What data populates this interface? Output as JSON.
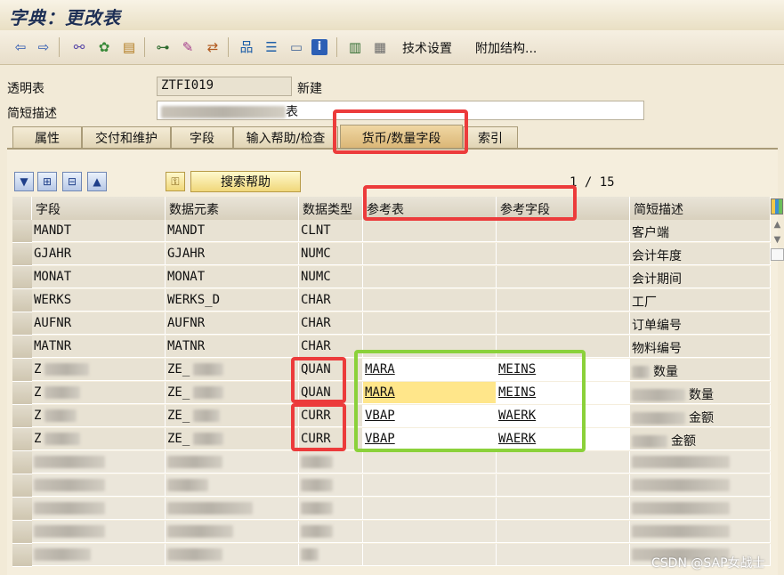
{
  "window": {
    "title": "字典：更改表"
  },
  "toolbar": {
    "tech_settings": "技术设置",
    "append_structure": "附加结构..."
  },
  "header": {
    "transparent_table_label": "透明表",
    "table_name": "ZTFI019",
    "status": "新建",
    "short_desc_label": "简短描述",
    "short_desc_suffix": "表"
  },
  "tabs": [
    {
      "label": "属性"
    },
    {
      "label": "交付和维护"
    },
    {
      "label": "字段"
    },
    {
      "label": "输入帮助/检查"
    },
    {
      "label": "货币/数量字段"
    },
    {
      "label": "索引"
    }
  ],
  "grid_toolbar": {
    "search_help": "搜索帮助",
    "pager": "1 / 15"
  },
  "columns": [
    "字段",
    "数据元素",
    "数据类型",
    "参考表",
    "参考字段",
    "简短描述"
  ],
  "rows": [
    {
      "field": "MANDT",
      "element": "MANDT",
      "type": "CLNT",
      "ref_table": "",
      "ref_field": "",
      "desc": "客户端"
    },
    {
      "field": "GJAHR",
      "element": "GJAHR",
      "type": "NUMC",
      "ref_table": "",
      "ref_field": "",
      "desc": "会计年度"
    },
    {
      "field": "MONAT",
      "element": "MONAT",
      "type": "NUMC",
      "ref_table": "",
      "ref_field": "",
      "desc": "会计期间"
    },
    {
      "field": "WERKS",
      "element": "WERKS_D",
      "type": "CHAR",
      "ref_table": "",
      "ref_field": "",
      "desc": "工厂"
    },
    {
      "field": "AUFNR",
      "element": "AUFNR",
      "type": "CHAR",
      "ref_table": "",
      "ref_field": "",
      "desc": "订单编号"
    },
    {
      "field": "MATNR",
      "element": "MATNR",
      "type": "CHAR",
      "ref_table": "",
      "ref_field": "",
      "desc": "物料编号"
    },
    {
      "field": "Z",
      "element": "ZE_",
      "type": "QUAN",
      "ref_table": "MARA",
      "ref_field": "MEINS",
      "desc": "数量"
    },
    {
      "field": "Z",
      "element": "ZE_",
      "type": "QUAN",
      "ref_table": "MARA",
      "ref_field": "MEINS",
      "desc": "数量"
    },
    {
      "field": "Z",
      "element": "ZE_",
      "type": "CURR",
      "ref_table": "VBAP",
      "ref_field": "WAERK",
      "desc": "金额"
    },
    {
      "field": "Z",
      "element": "ZE_",
      "type": "CURR",
      "ref_table": "VBAP",
      "ref_field": "WAERK",
      "desc": "金额"
    }
  ],
  "watermark": "CSDN @SAP女战士",
  "colors": {
    "highlight_red": "#ec3b3b",
    "highlight_green": "#8bd13a",
    "active_tab": "#d9b473"
  }
}
